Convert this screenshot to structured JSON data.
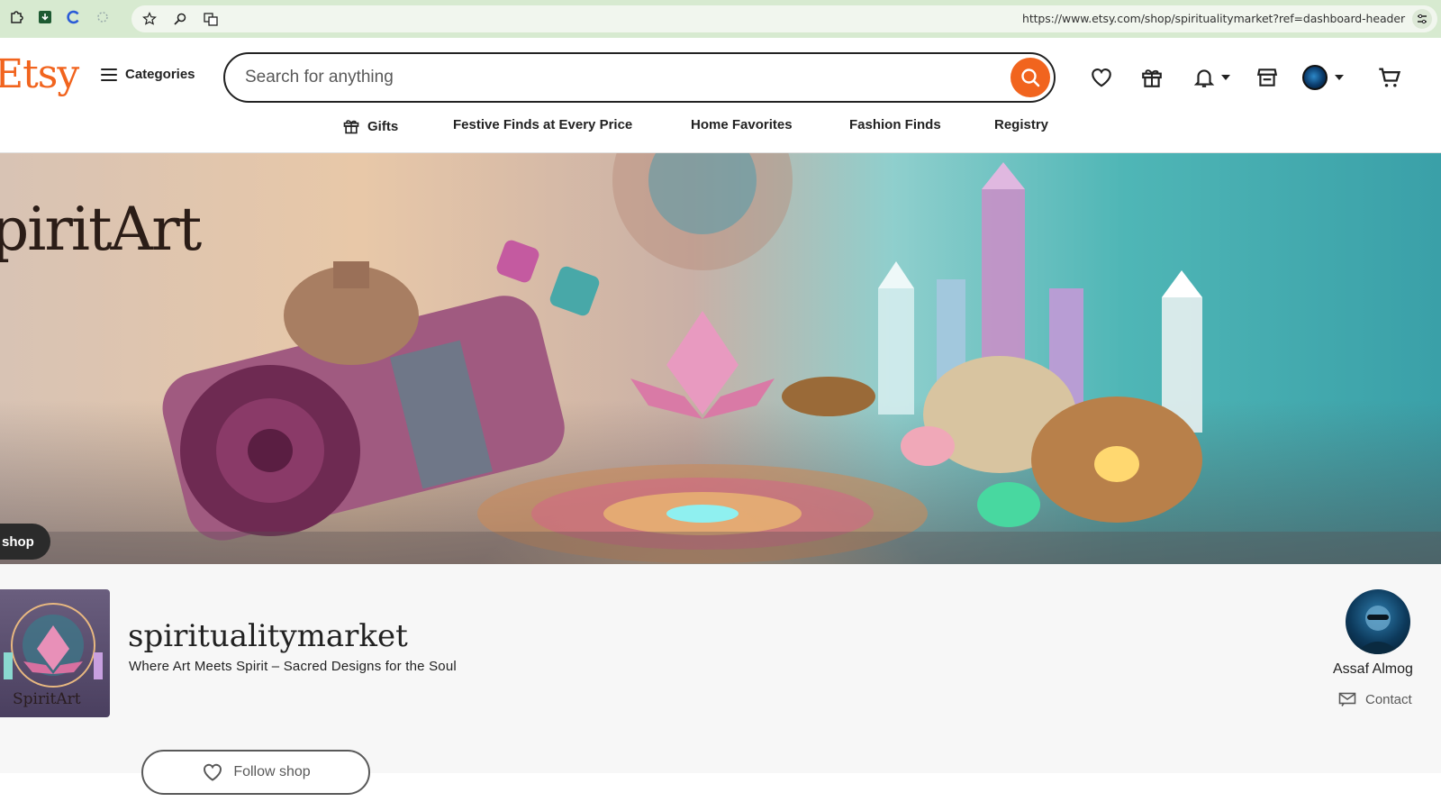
{
  "browser": {
    "url": "https://www.etsy.com/shop/spiritualitymarket?ref=dashboard-header",
    "extension_icons": [
      "puzzle-icon",
      "download-icon",
      "refresh-c-icon",
      "sparkle-icon"
    ],
    "omnibox_icons": [
      "star-icon",
      "zoom-icon",
      "translate-icon"
    ]
  },
  "header": {
    "logo": "Etsy",
    "categories_label": "Categories",
    "search_placeholder": "Search for anything",
    "icons": [
      "heart-icon",
      "gift-icon",
      "bell-icon",
      "shop-icon",
      "account-avatar",
      "cart-icon"
    ]
  },
  "subnav": {
    "items": [
      "Gifts",
      "Festive Finds at Every Price",
      "Home Favorites",
      "Fashion Finds",
      "Registry"
    ]
  },
  "banner": {
    "title": "piritArt",
    "label": "shop"
  },
  "shop": {
    "logo_text": "SpiritArt",
    "name": "spiritualitymarket",
    "tagline": "Where Art Meets Spirit – Sacred Designs for the Soul",
    "owner_name": "Assaf Almog",
    "contact_label": "Contact",
    "follow_label": "Follow shop"
  },
  "colors": {
    "brand": "#f1641e",
    "browser_bar": "#d7ead0",
    "shop_bg": "#f7f7f7"
  }
}
